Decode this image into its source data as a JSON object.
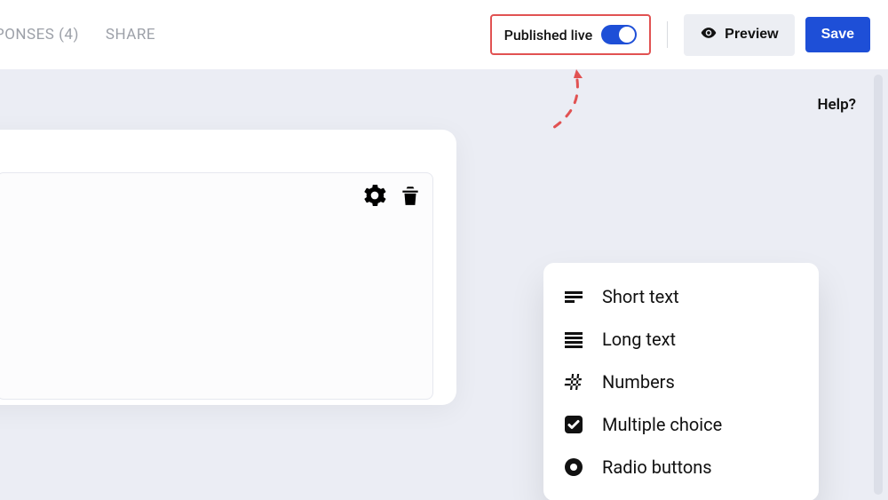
{
  "topbar": {
    "tabs": [
      {
        "label": "PONSES (4)"
      },
      {
        "label": "SHARE"
      }
    ],
    "publish_label": "Published live",
    "publish_on": true,
    "preview_label": "Preview",
    "save_label": "Save"
  },
  "help_label": "Help?",
  "field_menu": {
    "items": [
      {
        "icon": "short-text-icon",
        "label": "Short text"
      },
      {
        "icon": "long-text-icon",
        "label": "Long text"
      },
      {
        "icon": "numbers-icon",
        "label": "Numbers"
      },
      {
        "icon": "multiple-choice-icon",
        "label": "Multiple choice"
      },
      {
        "icon": "radio-buttons-icon",
        "label": "Radio buttons"
      }
    ]
  }
}
